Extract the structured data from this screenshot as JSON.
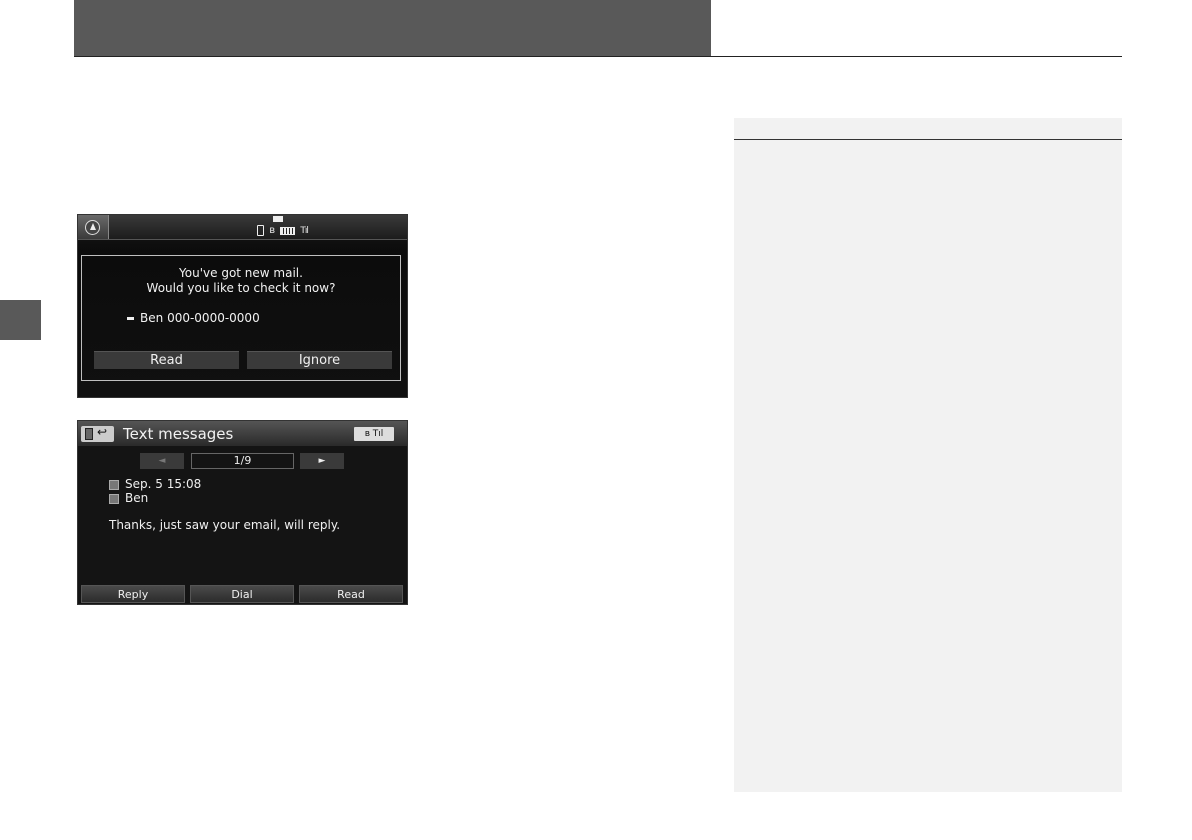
{
  "screen1": {
    "status_icons": [
      "nav-icon",
      "phone-icon",
      "bluetooth-icon",
      "battery-icon",
      "signal-icon",
      "mail-icon"
    ],
    "dialog": {
      "line1": "You've got new mail.",
      "line2": "Would you like to check it now?",
      "contact_name": "Ben",
      "contact_number": "000-0000-0000",
      "read_label": "Read",
      "ignore_label": "Ignore"
    }
  },
  "screen2": {
    "title": "Text messages",
    "bt_status": "ʙ Tıl",
    "pager": {
      "prev": "◄",
      "count": "1/9",
      "next": "►"
    },
    "date": "Sep. 5 15:08",
    "from": "Ben",
    "body": "Thanks, just saw your email, will reply.",
    "buttons": {
      "reply": "Reply",
      "dial": "Dial",
      "read": "Read"
    }
  }
}
